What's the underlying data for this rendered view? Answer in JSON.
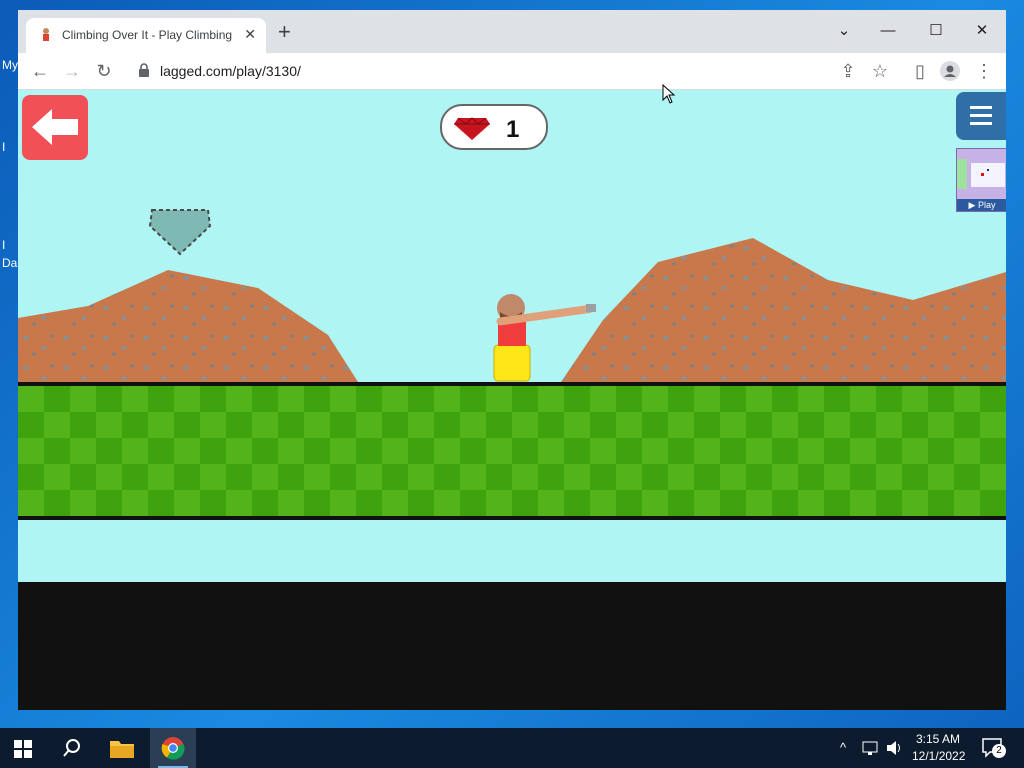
{
  "desktop": {
    "labels": [
      "My",
      "I",
      "I",
      "Da"
    ]
  },
  "browser": {
    "tab": {
      "title": "Climbing Over It - Play Climbing",
      "close_glyph": "✕"
    },
    "new_tab_glyph": "+",
    "window_controls": {
      "dropdown": "⌄",
      "minimize": "—",
      "maximize": "☐",
      "close": "✕"
    },
    "nav": {
      "back": "←",
      "forward": "→",
      "reload": "↻"
    },
    "url": "lagged.com/play/3130/",
    "toolbar_icons": {
      "share": "⇪",
      "star": "☆",
      "sidebar": "▯",
      "menu": "⋮"
    }
  },
  "game": {
    "gem_count": "1",
    "ad_play_label": "▶ Play",
    "colors": {
      "sky": "#aef5f3",
      "grass": "#52b31b",
      "dirt": "#c8784a",
      "back_button": "#f05056",
      "menu_button": "#2f6ea6"
    }
  },
  "taskbar": {
    "time": "3:15 AM",
    "date": "12/1/2022",
    "notification_count": "2"
  }
}
